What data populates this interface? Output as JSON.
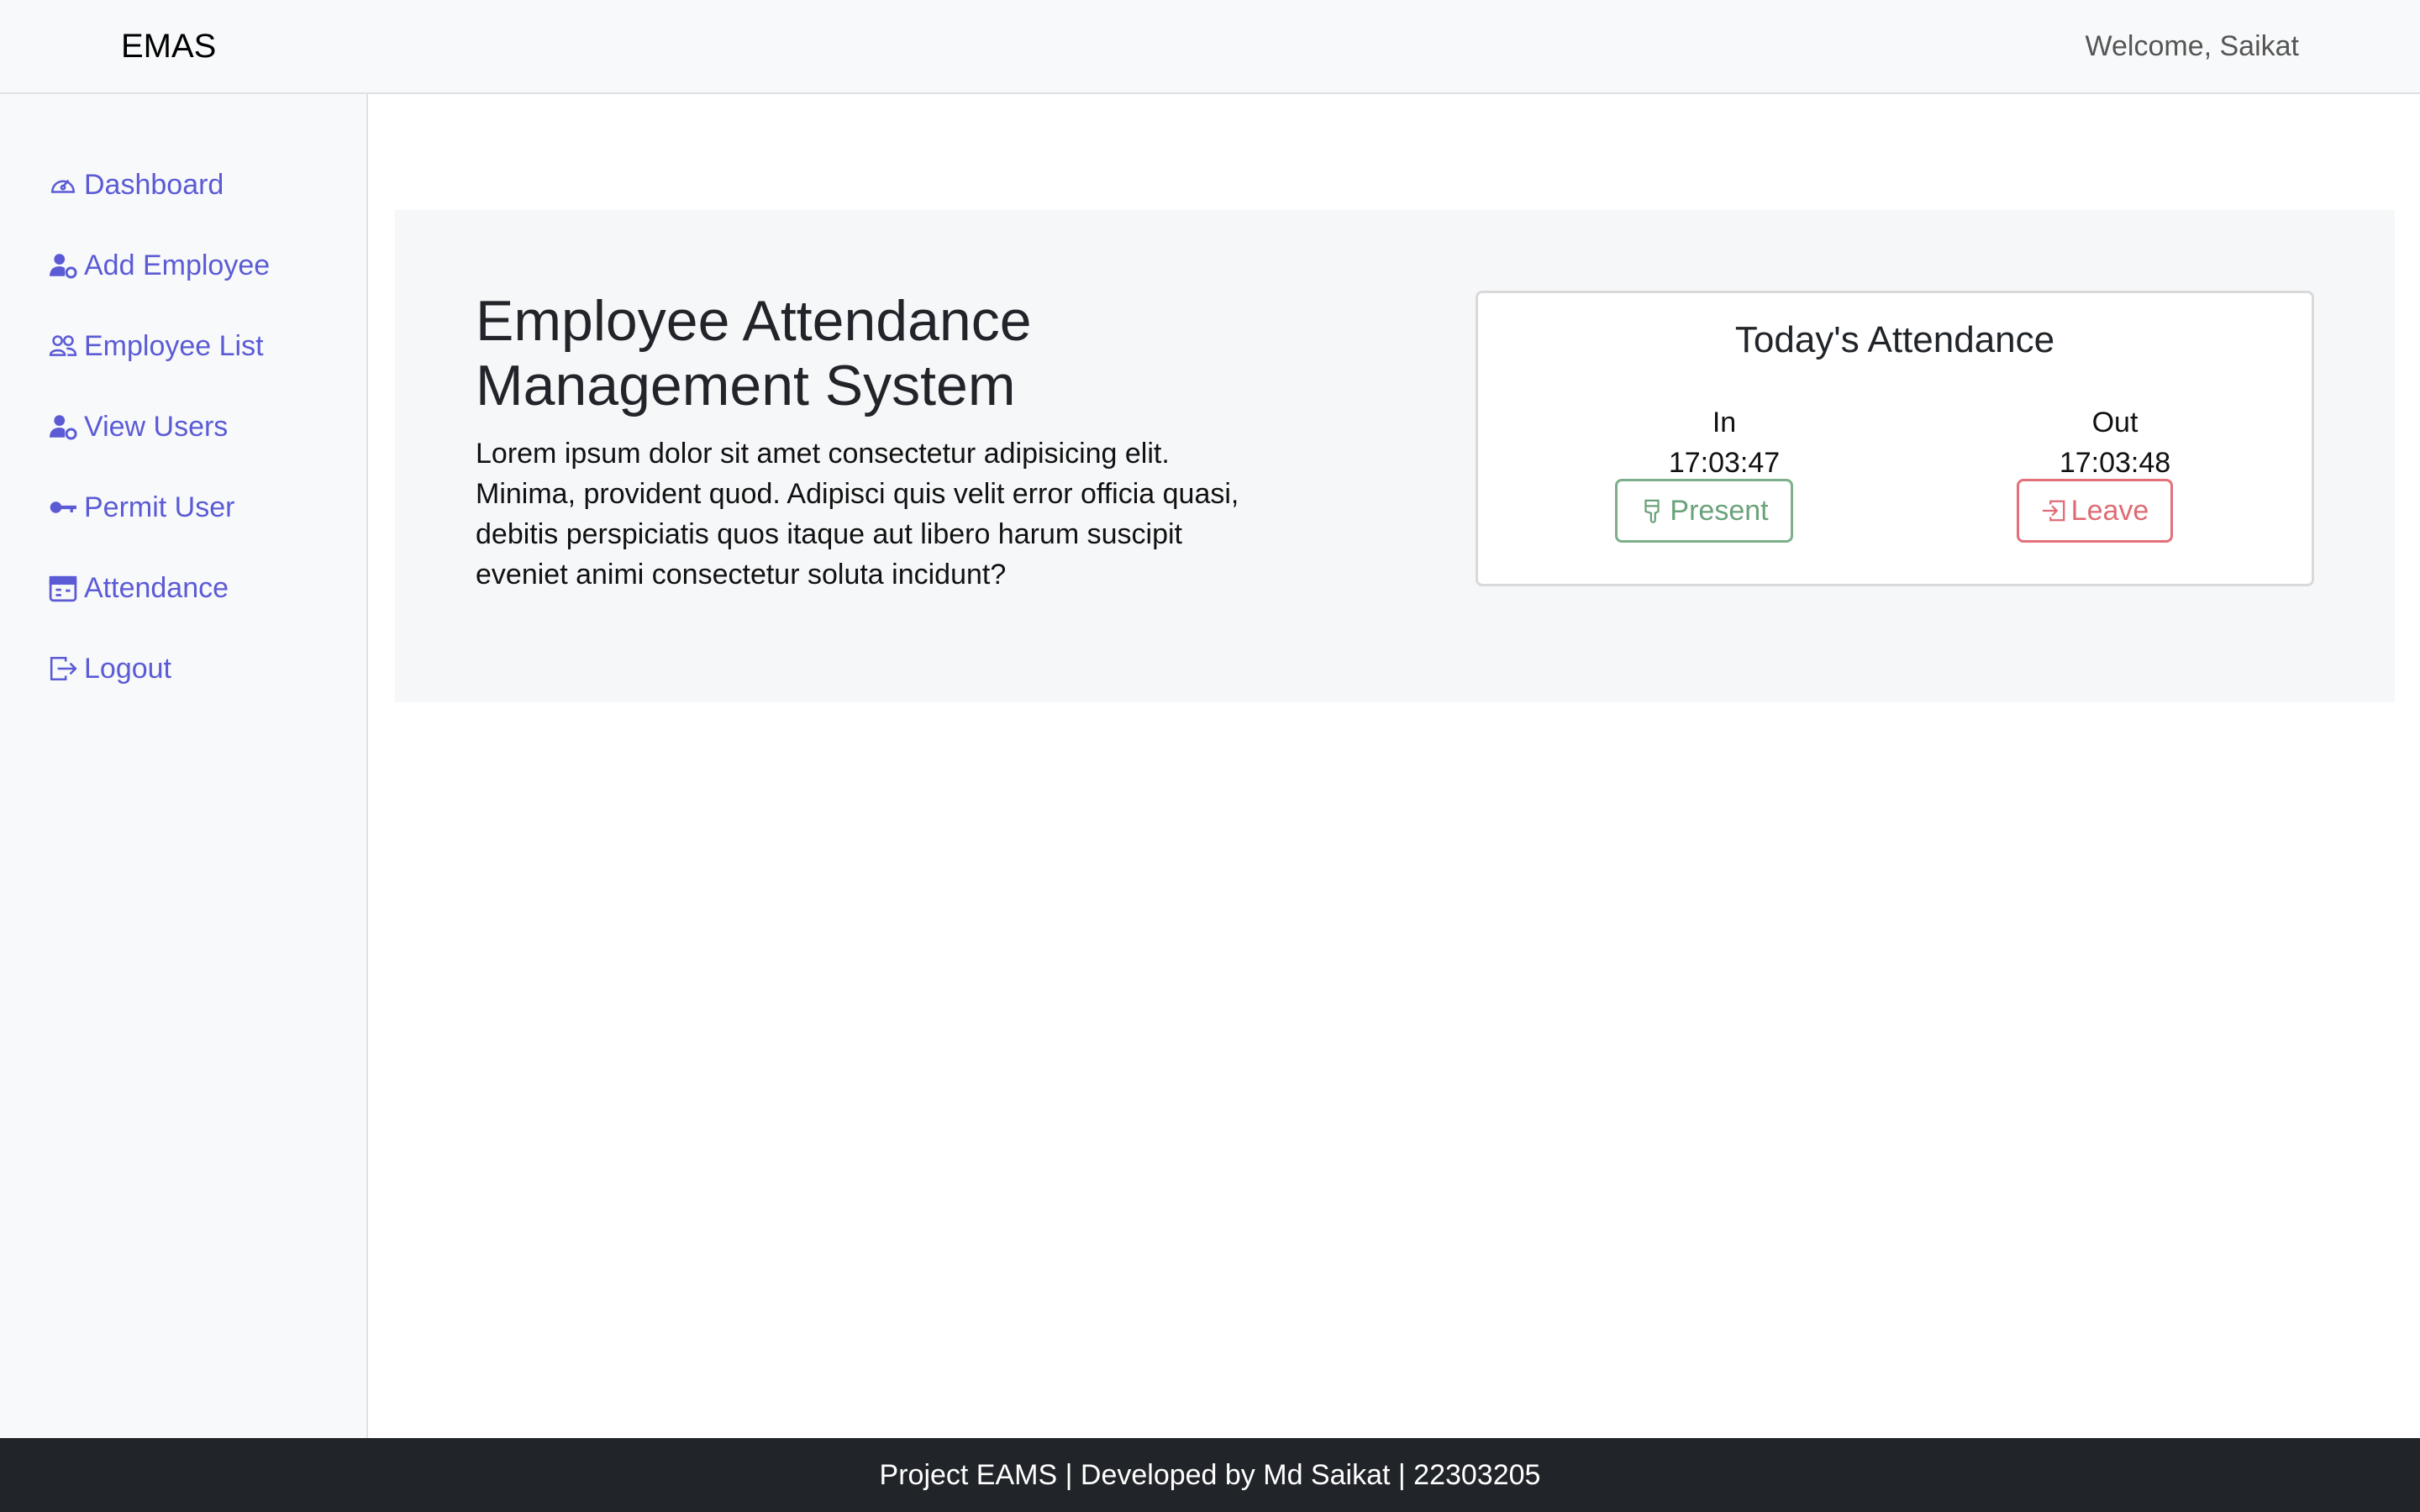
{
  "navbar": {
    "brand": "EMAS",
    "welcome": "Welcome, Saikat"
  },
  "sidebar": {
    "items": [
      {
        "label": "Dashboard",
        "icon": "speedometer-icon"
      },
      {
        "label": "Add Employee",
        "icon": "person-gear-icon"
      },
      {
        "label": "Employee List",
        "icon": "people-icon"
      },
      {
        "label": "View Users",
        "icon": "person-gear-icon"
      },
      {
        "label": "Permit User",
        "icon": "key-icon"
      },
      {
        "label": "Attendance",
        "icon": "calendar-card-icon"
      },
      {
        "label": "Logout",
        "icon": "box-arrow-right-icon"
      }
    ]
  },
  "hero": {
    "title_line1": "Employee Attendance",
    "title_line2": "Management System",
    "text_line1": "Lorem ipsum dolor sit amet consectetur adipisicing elit.",
    "text_line2": "Minima, provident quod. Adipisci quis velit error officia quasi,",
    "text_line3": "debitis perspiciatis quos itaque aut libero harum suscipit",
    "text_line4": "eveniet animi consectetur soluta incidunt?"
  },
  "attendance": {
    "title": "Today's Attendance",
    "in_label": "In",
    "in_time": "17:03:47",
    "out_label": "Out",
    "out_time": "17:03:48",
    "present_label": "Present",
    "leave_label": "Leave"
  },
  "colors": {
    "accent": "#5b5bd6",
    "present": "#6aa27a",
    "leave": "#df6b74",
    "footer_bg": "#212529"
  },
  "footer": {
    "text": "Project EAMS | Developed by Md Saikat | 22303205"
  }
}
